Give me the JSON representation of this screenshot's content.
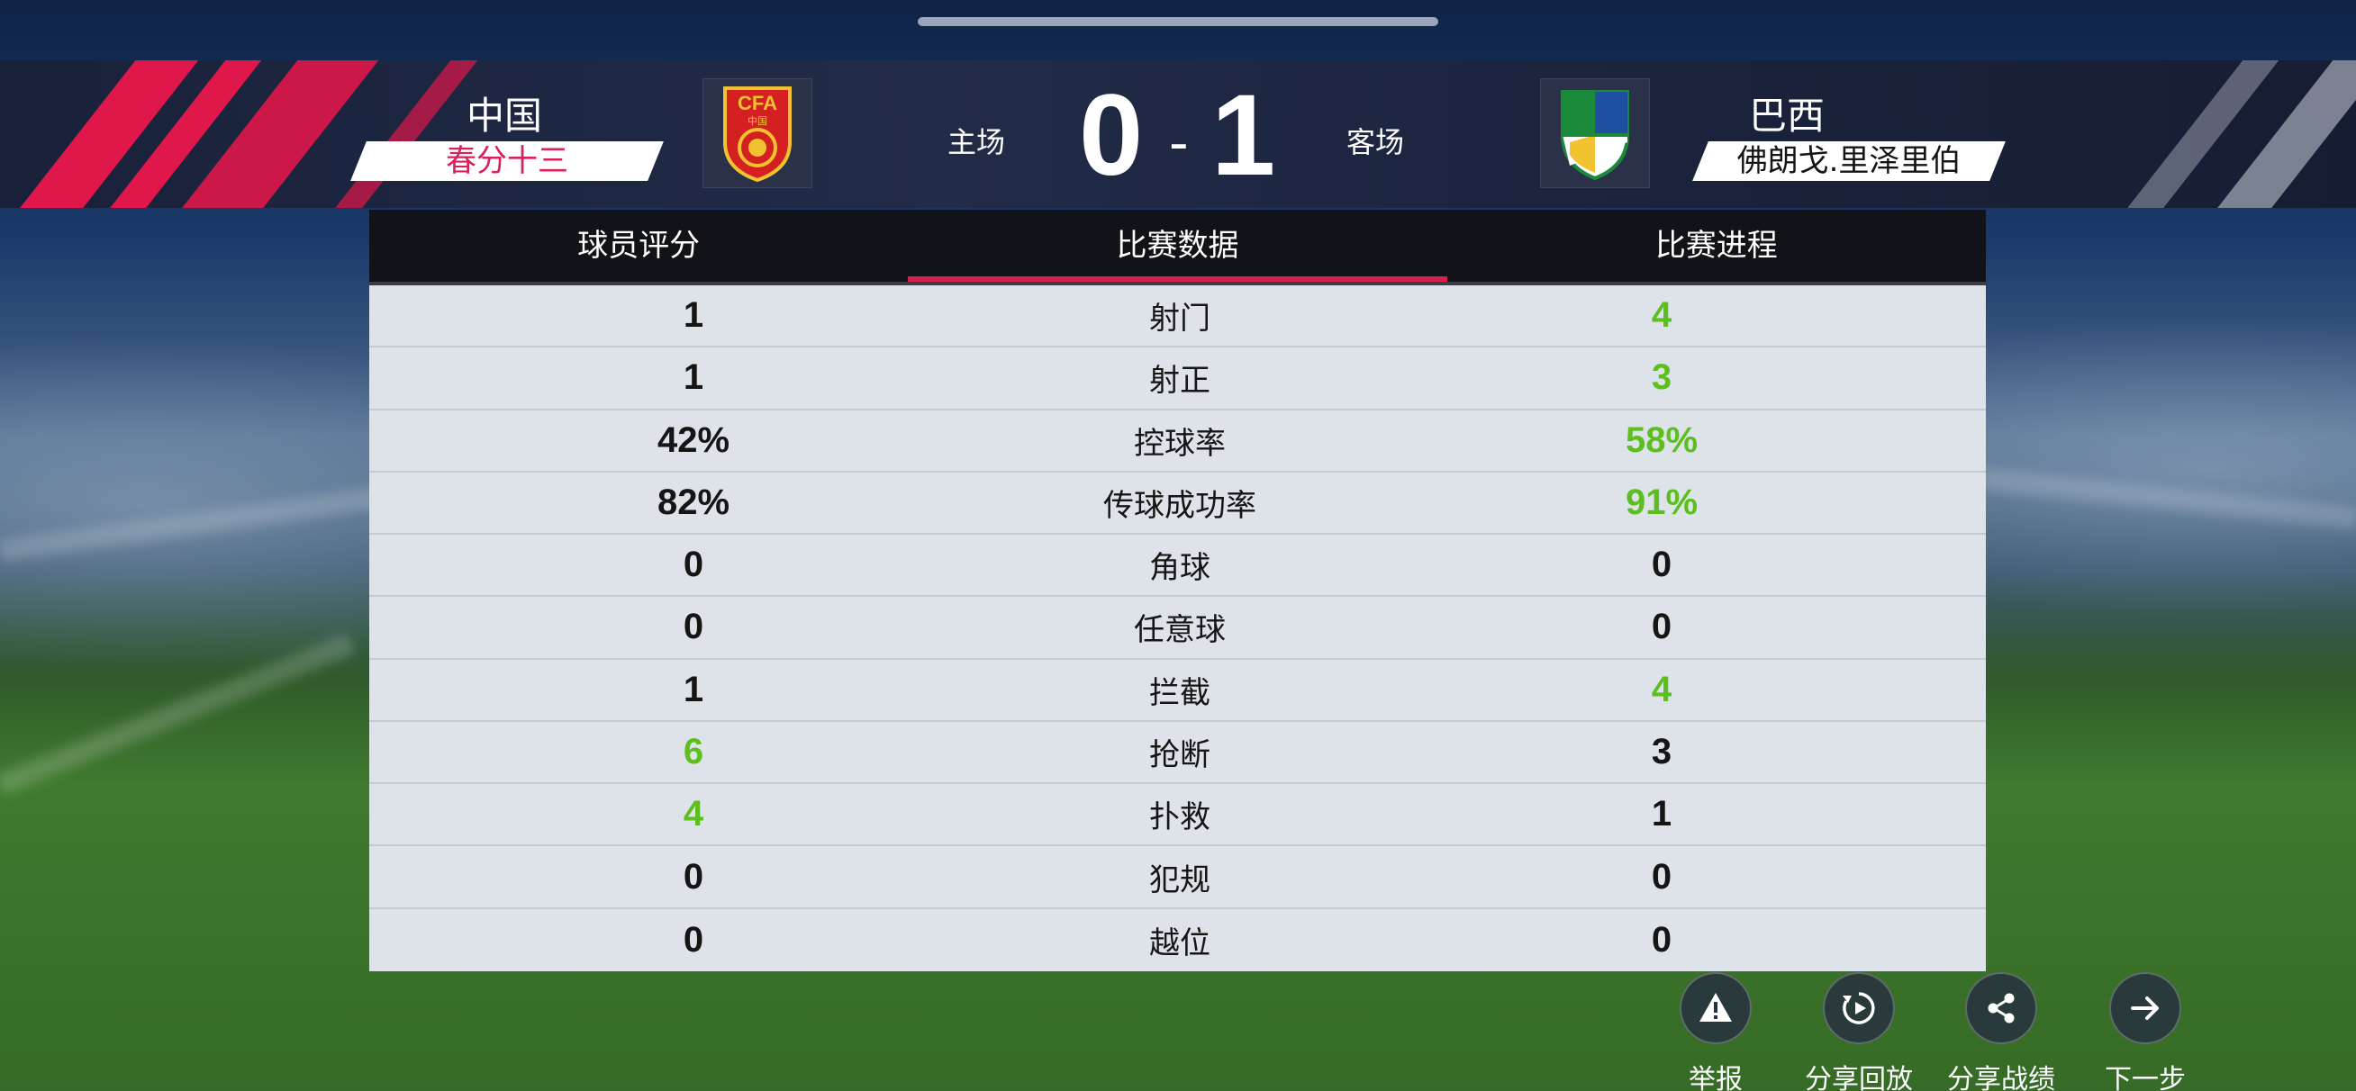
{
  "header": {
    "home_team": "中国",
    "home_player": "春分十三",
    "home_side_label": "主场",
    "away_team": "巴西",
    "away_player": "佛朗戈.里泽里伯",
    "away_side_label": "客场",
    "home_score": "0",
    "score_separator": "-",
    "away_score": "1",
    "home_badge_text": "CFA",
    "home_badge_sub": "中国"
  },
  "tabs": [
    {
      "label": "球员评分",
      "active": false
    },
    {
      "label": "比赛数据",
      "active": true
    },
    {
      "label": "比赛进程",
      "active": false
    }
  ],
  "stats": [
    {
      "label": "射门",
      "home": "1",
      "away": "4",
      "winner": "away"
    },
    {
      "label": "射正",
      "home": "1",
      "away": "3",
      "winner": "away"
    },
    {
      "label": "控球率",
      "home": "42%",
      "away": "58%",
      "winner": "away"
    },
    {
      "label": "传球成功率",
      "home": "82%",
      "away": "91%",
      "winner": "away"
    },
    {
      "label": "角球",
      "home": "0",
      "away": "0",
      "winner": "none"
    },
    {
      "label": "任意球",
      "home": "0",
      "away": "0",
      "winner": "none"
    },
    {
      "label": "拦截",
      "home": "1",
      "away": "4",
      "winner": "away"
    },
    {
      "label": "抢断",
      "home": "6",
      "away": "3",
      "winner": "home"
    },
    {
      "label": "扑救",
      "home": "4",
      "away": "1",
      "winner": "home"
    },
    {
      "label": "犯规",
      "home": "0",
      "away": "0",
      "winner": "none"
    },
    {
      "label": "越位",
      "home": "0",
      "away": "0",
      "winner": "none"
    }
  ],
  "actions": [
    {
      "label": "举报",
      "icon": "warning-icon"
    },
    {
      "label": "分享回放",
      "icon": "replay-icon"
    },
    {
      "label": "分享战绩",
      "icon": "share-icon"
    },
    {
      "label": "下一步",
      "icon": "arrow-right-icon"
    }
  ],
  "colors": {
    "accent": "#d8204e",
    "win_value": "#5cbf1f",
    "player_tag_pink": "#d8205a",
    "player_tag_dark": "#151515"
  }
}
